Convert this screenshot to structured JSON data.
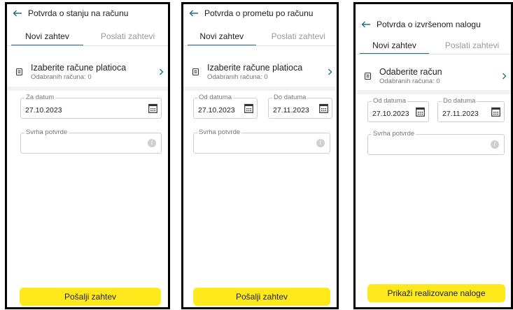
{
  "panels": [
    {
      "title": "Potvrda o stanju na računu",
      "tabs": [
        "Novi zahtev",
        "Poslati zahtevi"
      ],
      "account": {
        "title": "Izaberite račune platioca",
        "subtitle": "Odabranih računa: 0",
        "icon": "card-icon"
      },
      "date_fields": [
        {
          "label": "Za datum",
          "value": "27.10.2023"
        }
      ],
      "purpose_label": "Svrha potvrde",
      "button": "Pošalji zahtev"
    },
    {
      "title": "Potvrda o prometu po računu",
      "tabs": [
        "Novi zahtev",
        "Poslati zahtevi"
      ],
      "account": {
        "title": "Izaberite račune platioca",
        "subtitle": "Odabranih računa: 0",
        "icon": "card-icon"
      },
      "date_fields": [
        {
          "label": "Od datuma",
          "value": "27.10.2023"
        },
        {
          "label": "Do datuma",
          "value": "27.11.2023"
        }
      ],
      "purpose_label": "Svrha potvrde",
      "button": "Pošalji zahtev"
    },
    {
      "title": "Potvrda o izvršenom nalogu",
      "tabs": [
        "Novi zahtev",
        "Poslati zahtevi"
      ],
      "account": {
        "title": "Odaberite račun",
        "subtitle": "Odabranih računa: 0",
        "icon": "card-icon"
      },
      "date_fields": [
        {
          "label": "Od datuma",
          "value": "27.10.2023"
        },
        {
          "label": "Do datuma",
          "value": "27.11.2023"
        }
      ],
      "purpose_label": "Svrha potvrde",
      "button": "Prikaži realizovane naloge"
    }
  ],
  "colors": {
    "accent_tab": "#1f6f8b",
    "button_yellow": "#ffe81c",
    "chevron_blue": "#1f6f8b"
  }
}
